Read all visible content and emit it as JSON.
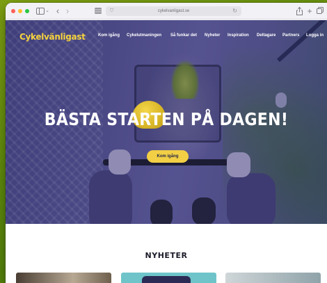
{
  "browser": {
    "url": "cykelvanligast.se",
    "icons": [
      "sidebar-icon",
      "chevron-down-icon",
      "back-arrow-icon",
      "forward-arrow-icon",
      "tab-overview-icon",
      "shield-icon",
      "reload-icon",
      "share-icon",
      "plus-icon",
      "tabs-icon"
    ]
  },
  "site": {
    "logo": "Cykelvänligast",
    "nav": [
      "Kom igång",
      "Cykelutmaningen",
      "Så funkar det",
      "Nyheter",
      "Inspiration",
      "Deltagare",
      "Partners",
      "Logga in"
    ],
    "hero": {
      "title": "BÄSTA STARTEN PÅ DAGEN!",
      "cta_label": "Kom igång"
    },
    "news": {
      "title": "NYHETER"
    }
  },
  "colors": {
    "accent": "#f2cf45",
    "hero_overlay": "#4a4884",
    "desktop": "#6b8f0e"
  }
}
